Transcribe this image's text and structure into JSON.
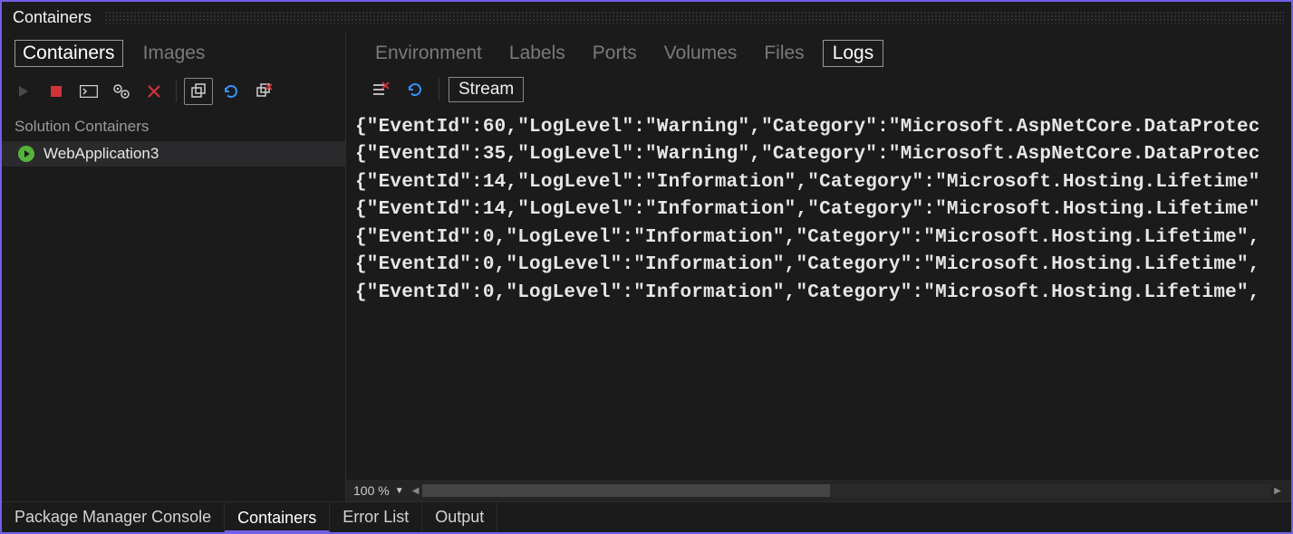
{
  "panel": {
    "title": "Containers"
  },
  "sidebar": {
    "tabs": [
      {
        "label": "Containers",
        "active": true
      },
      {
        "label": "Images",
        "active": false
      }
    ],
    "section_label": "Solution Containers",
    "items": [
      {
        "label": "WebApplication3",
        "running": true
      }
    ]
  },
  "main": {
    "tabs": [
      {
        "label": "Environment",
        "active": false
      },
      {
        "label": "Labels",
        "active": false
      },
      {
        "label": "Ports",
        "active": false
      },
      {
        "label": "Volumes",
        "active": false
      },
      {
        "label": "Files",
        "active": false
      },
      {
        "label": "Logs",
        "active": true
      }
    ],
    "stream_label": "Stream",
    "zoom": "100 %"
  },
  "logs": [
    "{\"EventId\":60,\"LogLevel\":\"Warning\",\"Category\":\"Microsoft.AspNetCore.DataProtec",
    "{\"EventId\":35,\"LogLevel\":\"Warning\",\"Category\":\"Microsoft.AspNetCore.DataProtec",
    "{\"EventId\":14,\"LogLevel\":\"Information\",\"Category\":\"Microsoft.Hosting.Lifetime\"",
    "{\"EventId\":14,\"LogLevel\":\"Information\",\"Category\":\"Microsoft.Hosting.Lifetime\"",
    "{\"EventId\":0,\"LogLevel\":\"Information\",\"Category\":\"Microsoft.Hosting.Lifetime\",",
    "{\"EventId\":0,\"LogLevel\":\"Information\",\"Category\":\"Microsoft.Hosting.Lifetime\",",
    "{\"EventId\":0,\"LogLevel\":\"Information\",\"Category\":\"Microsoft.Hosting.Lifetime\","
  ],
  "bottom_tabs": [
    {
      "label": "Package Manager Console",
      "active": false
    },
    {
      "label": "Containers",
      "active": true
    },
    {
      "label": "Error List",
      "active": false
    },
    {
      "label": "Output",
      "active": false
    }
  ]
}
